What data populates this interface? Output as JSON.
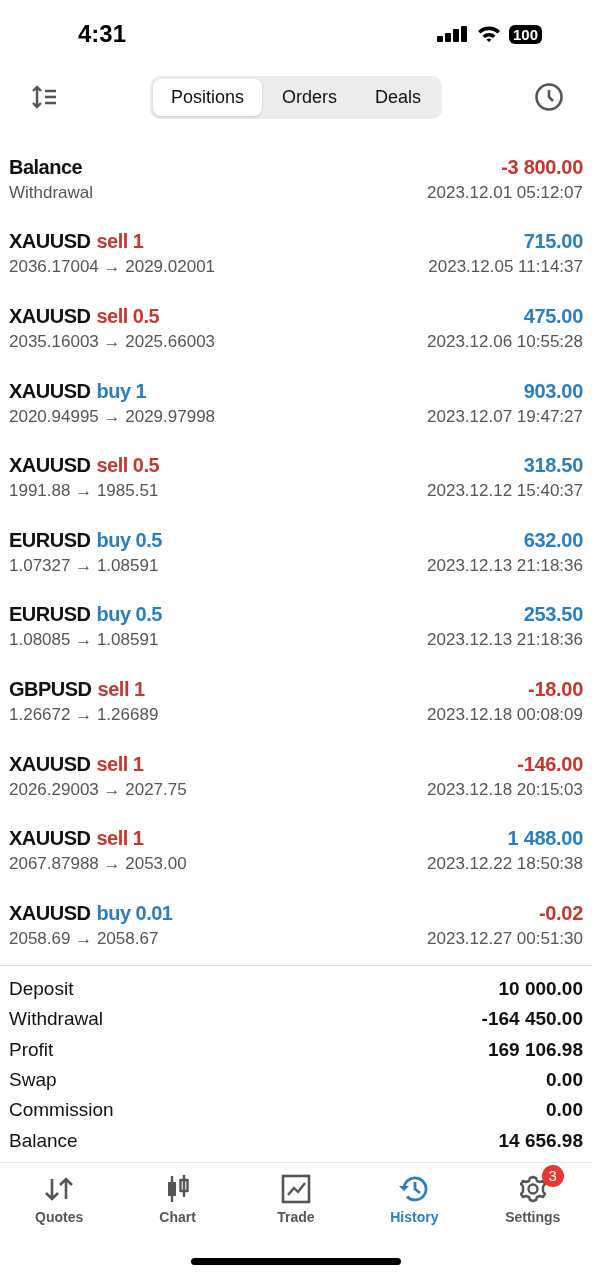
{
  "status_bar": {
    "time": "4:31",
    "battery": "100"
  },
  "tabs": [
    {
      "label": "Positions",
      "selected": true
    },
    {
      "label": "Orders",
      "selected": false
    },
    {
      "label": "Deals",
      "selected": false
    }
  ],
  "deals": [
    {
      "kind": "balance",
      "title": "Balance",
      "detail": "Withdrawal",
      "amount": {
        "text": "-3 800.00",
        "color": "#c8372d"
      },
      "time": "2023.12.01 05:12:07"
    },
    {
      "kind": "trade",
      "title": "XAUUSD",
      "action": {
        "text": "sell 1",
        "color": "#c8372d"
      },
      "detail": "2036.17004 → 2029.02001",
      "amount": {
        "text": "715.00",
        "color": "#2a7fc1"
      },
      "time": "2023.12.05 11:14:37"
    },
    {
      "kind": "trade",
      "title": "XAUUSD",
      "action": {
        "text": "sell 0.5",
        "color": "#c8372d"
      },
      "detail": "2035.16003 → 2025.66003",
      "amount": {
        "text": "475.00",
        "color": "#2a7fc1"
      },
      "time": "2023.12.06 10:55:28"
    },
    {
      "kind": "trade",
      "title": "XAUUSD",
      "action": {
        "text": "buy 1",
        "color": "#2a7fc1"
      },
      "detail": "2020.94995 → 2029.97998",
      "amount": {
        "text": "903.00",
        "color": "#2a7fc1"
      },
      "time": "2023.12.07 19:47:27"
    },
    {
      "kind": "trade",
      "title": "XAUUSD",
      "action": {
        "text": "sell 0.5",
        "color": "#c8372d"
      },
      "detail": "1991.88 → 1985.51",
      "amount": {
        "text": "318.50",
        "color": "#2a7fc1"
      },
      "time": "2023.12.12 15:40:37"
    },
    {
      "kind": "trade",
      "title": "EURUSD",
      "action": {
        "text": "buy 0.5",
        "color": "#2a7fc1"
      },
      "detail": "1.07327 → 1.08591",
      "amount": {
        "text": "632.00",
        "color": "#2a7fc1"
      },
      "time": "2023.12.13 21:18:36"
    },
    {
      "kind": "trade",
      "title": "EURUSD",
      "action": {
        "text": "buy 0.5",
        "color": "#2a7fc1"
      },
      "detail": "1.08085 → 1.08591",
      "amount": {
        "text": "253.50",
        "color": "#2a7fc1"
      },
      "time": "2023.12.13 21:18:36"
    },
    {
      "kind": "trade",
      "title": "GBPUSD",
      "action": {
        "text": "sell 1",
        "color": "#c8372d"
      },
      "detail": "1.26672 → 1.26689",
      "amount": {
        "text": "-18.00",
        "color": "#c8372d"
      },
      "time": "2023.12.18 00:08:09"
    },
    {
      "kind": "trade",
      "title": "XAUUSD",
      "action": {
        "text": "sell 1",
        "color": "#c8372d"
      },
      "detail": "2026.29003 → 2027.75",
      "amount": {
        "text": "-146.00",
        "color": "#c8372d"
      },
      "time": "2023.12.18 20:15:03"
    },
    {
      "kind": "trade",
      "title": "XAUUSD",
      "action": {
        "text": "sell 1",
        "color": "#c8372d"
      },
      "detail": "2067.87988 → 2053.00",
      "amount": {
        "text": "1 488.00",
        "color": "#2a7fc1"
      },
      "time": "2023.12.22 18:50:38"
    },
    {
      "kind": "trade",
      "title": "XAUUSD",
      "action": {
        "text": "buy 0.01",
        "color": "#2a7fc1"
      },
      "detail": "2058.69 → 2058.67",
      "amount": {
        "text": "-0.02",
        "color": "#c8372d"
      },
      "time": "2023.12.27 00:51:30"
    }
  ],
  "summary": [
    {
      "label": "Deposit",
      "value": "10 000.00"
    },
    {
      "label": "Withdrawal",
      "value": "-164 450.00"
    },
    {
      "label": "Profit",
      "value": "169 106.98"
    },
    {
      "label": "Swap",
      "value": "0.00"
    },
    {
      "label": "Commission",
      "value": "0.00"
    },
    {
      "label": "Balance",
      "value": "14 656.98"
    }
  ],
  "nav": [
    {
      "kind": "quotes",
      "label": "Quotes",
      "selected": false
    },
    {
      "kind": "chart",
      "label": "Chart",
      "selected": false
    },
    {
      "kind": "trade",
      "label": "Trade",
      "selected": false
    },
    {
      "kind": "history",
      "label": "History",
      "selected": true
    },
    {
      "kind": "settings",
      "label": "Settings",
      "selected": false,
      "badge": "3"
    }
  ]
}
